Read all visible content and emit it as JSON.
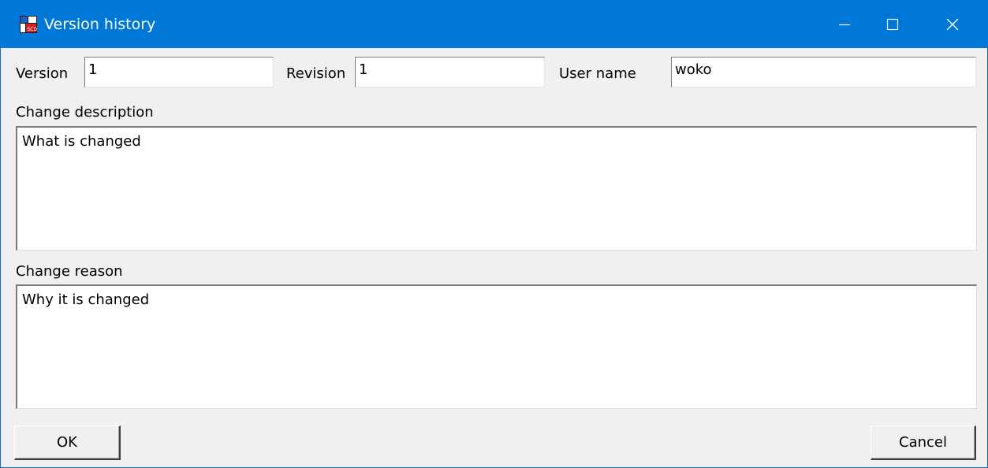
{
  "window": {
    "title": "Version history",
    "accent": "#0078d7"
  },
  "titlebar": {
    "app_icon": "app-icon",
    "minimize_icon": "minimize-icon",
    "maximize_icon": "maximize-icon",
    "close_icon": "close-icon"
  },
  "form": {
    "version_label": "Version",
    "version_value": "1",
    "revision_label": "Revision",
    "revision_value": "1",
    "username_label": "User name",
    "username_value": "woko",
    "change_description_label": "Change description",
    "change_description_value": "What is changed",
    "change_reason_label": "Change reason",
    "change_reason_value": "Why it is changed"
  },
  "buttons": {
    "ok_label": "OK",
    "cancel_label": "Cancel"
  }
}
